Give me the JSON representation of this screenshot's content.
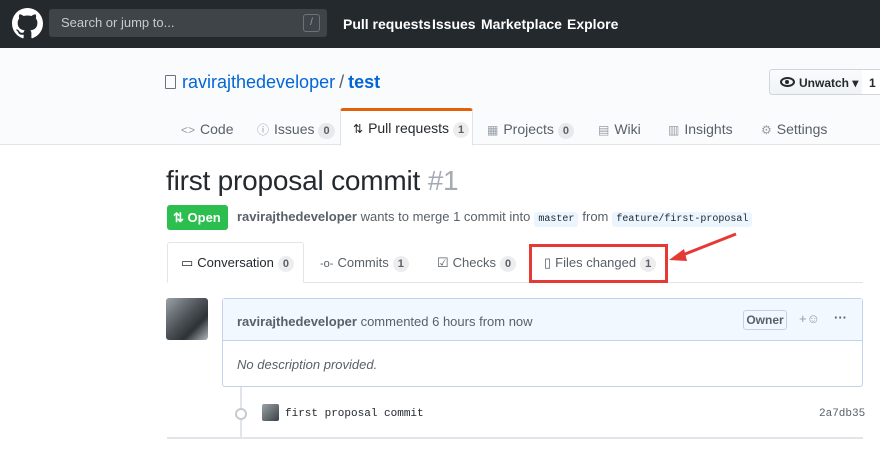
{
  "topbar": {
    "search_placeholder": "Search or jump to...",
    "slash_key": "/",
    "nav": [
      "Pull requests",
      "Issues",
      "Marketplace",
      "Explore"
    ]
  },
  "repo": {
    "owner": "ravirajthedeveloper",
    "separator": "/",
    "name": "test",
    "watch_label": "Unwatch ▾",
    "watch_count": "1"
  },
  "tabs": [
    {
      "icon": "<>",
      "label": "Code",
      "count": ""
    },
    {
      "icon": "ⓘ",
      "label": "Issues",
      "count": "0"
    },
    {
      "icon": "⇅",
      "label": "Pull requests",
      "count": "1"
    },
    {
      "icon": "▦",
      "label": "Projects",
      "count": "0"
    },
    {
      "icon": "▤",
      "label": "Wiki",
      "count": ""
    },
    {
      "icon": "▥",
      "label": "Insights",
      "count": ""
    },
    {
      "icon": "⚙",
      "label": "Settings",
      "count": ""
    }
  ],
  "pr": {
    "title": "first proposal commit",
    "number": "#1",
    "state": "Open",
    "author": "ravirajthedeveloper",
    "merge_text": "wants to merge 1 commit into",
    "base": "master",
    "from_text": "from",
    "head": "feature/first-proposal"
  },
  "subtabs": [
    {
      "icon": "▭",
      "label": "Conversation",
      "count": "0"
    },
    {
      "icon": "-o-",
      "label": "Commits",
      "count": "1"
    },
    {
      "icon": "☑",
      "label": "Checks",
      "count": "0"
    },
    {
      "icon": "▯",
      "label": "Files changed",
      "count": "1"
    }
  ],
  "comment": {
    "author": "ravirajthedeveloper",
    "action": "commented 6 hours from now",
    "badge": "Owner",
    "react": "+☺",
    "more": "···",
    "body": "No description provided."
  },
  "commit": {
    "message": "first proposal commit",
    "sha": "2a7db35"
  },
  "colors": {
    "header": "#24292e",
    "open": "#2cbe4e",
    "link": "#0366d6",
    "highlight": "#e53935"
  }
}
